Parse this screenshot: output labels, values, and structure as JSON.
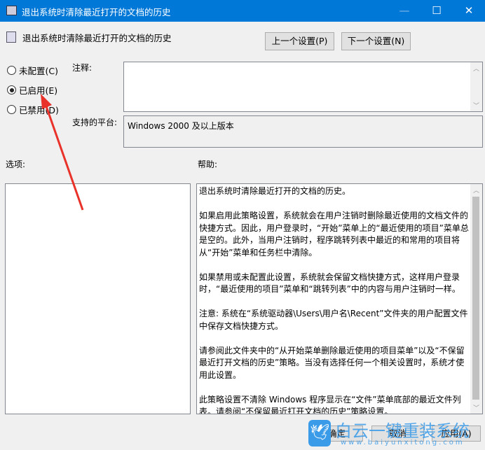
{
  "window": {
    "title": "退出系统时清除最近打开的文档的历史",
    "accent": "#0078d7"
  },
  "header": {
    "title": "退出系统时清除最近打开的文档的历史",
    "prev_label": "上一个设置(P)",
    "next_label": "下一个设置(N)"
  },
  "state": {
    "options": [
      {
        "label": "未配置(C)",
        "selected": false
      },
      {
        "label": "已启用(E)",
        "selected": true
      },
      {
        "label": "已禁用(D)",
        "selected": false
      }
    ]
  },
  "comment": {
    "label": "注释:",
    "value": ""
  },
  "platform": {
    "label": "支持的平台:",
    "value": "Windows 2000 及以上版本"
  },
  "options_label": "选项:",
  "help_label": "帮助:",
  "help_paragraphs": [
    "退出系统时清除最近打开的文档的历史。",
    "如果启用此策略设置，系统就会在用户注销时删除最近使用的文档文件的快捷方式。因此，用户登录时，“开始”菜单上的“最近使用的项目”菜单总是空的。此外，当用户注销时，程序跳转列表中最近的和常用的项目将从“开始”菜单和任务栏中清除。",
    "如果禁用或未配置此设置，系统就会保留文档快捷方式，这样用户登录时，“最近使用的项目”菜单和“跳转列表”中的内容与用户注销时一样。",
    "注意: 系统在“系统驱动器\\Users\\用户名\\Recent”文件夹的用户配置文件中保存文档快捷方式。",
    "请参阅此文件夹中的“从开始菜单删除最近使用的项目菜单”以及“不保留最近打开文档的历史”策略。当没有选择任何一个相关设置时，系统才使用此设置。",
    "此策略设置不清除 Windows 程序显示在“文件”菜单底部的最近文件列表。请参阅“不保留最近打开文档的历史”策略设置。"
  ],
  "footer": {
    "ok_label": "确定",
    "cancel_label": "取消",
    "apply_label": "应用(A)"
  },
  "annotation": {
    "arrow_color": "#e8322a"
  },
  "watermark": {
    "text": "白云一键重装系统",
    "url": "www.baiyunxitong.com"
  }
}
